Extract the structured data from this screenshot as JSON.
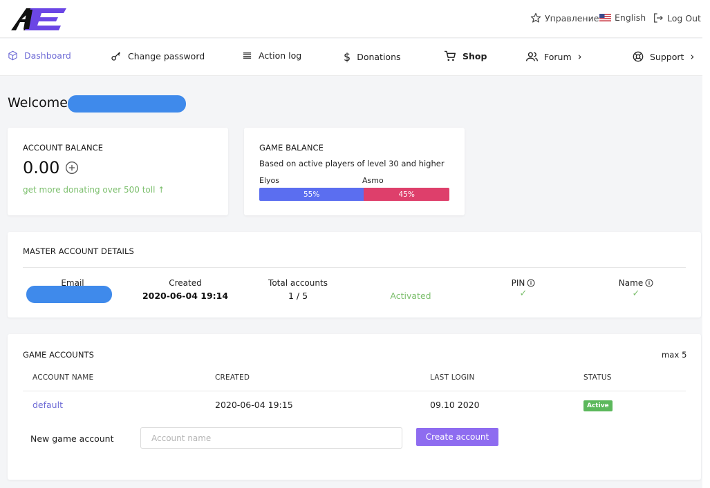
{
  "header": {
    "management_label": "Управление",
    "language_label": "English",
    "logout_label": "Log Out"
  },
  "nav": {
    "items": [
      {
        "label": "Dashboard",
        "icon": "cube-icon"
      },
      {
        "label": "Change password",
        "icon": "key-icon"
      },
      {
        "label": "Action log",
        "icon": "list-icon"
      },
      {
        "label": "Donations",
        "icon": "dollar-icon"
      },
      {
        "label": "Shop",
        "icon": "cart-icon"
      },
      {
        "label": "Forum",
        "icon": "users-icon"
      },
      {
        "label": "Support",
        "icon": "lifebuoy-icon"
      }
    ]
  },
  "welcome": "Welcome,",
  "account_balance": {
    "title": "ACCOUNT BALANCE",
    "amount": "0.00",
    "note": "get more donating over 500 toll ↑"
  },
  "game_balance": {
    "title": "GAME BALANCE",
    "subtitle": "Based on active players of level 30 and higher",
    "left_faction": "Elyos",
    "right_faction": "Asmo",
    "left_percent": 55,
    "right_percent": 45,
    "left_label": "55%",
    "right_label": "45%",
    "left_color": "#5b6ef0",
    "right_color": "#de3f6b"
  },
  "master": {
    "title": "MASTER ACCOUNT DETAILS",
    "email_label": "Email",
    "created_label": "Created",
    "created_value": "2020-06-04 19:14",
    "total_label": "Total accounts",
    "total_value": "1 / 5",
    "status_value": "Activated",
    "pin_label": "PIN",
    "name_label": "Name",
    "pin_check": "✓",
    "name_check": "✓"
  },
  "game_accounts": {
    "title": "GAME ACCOUNTS",
    "max_label": "max 5",
    "columns": [
      "ACCOUNT NAME",
      "CREATED",
      "LAST LOGIN",
      "STATUS"
    ],
    "rows": [
      {
        "name": "default",
        "created": "2020-06-04 19:15",
        "last_login": "09.10 2020",
        "status": "Active"
      }
    ],
    "new_label": "New game account",
    "input_placeholder": "Account name",
    "create_label": "Create account"
  },
  "colors": {
    "accent": "#6f6cd6",
    "button": "#8e6cf0",
    "success": "#7cbf6d",
    "badge": "#5cb85c"
  }
}
